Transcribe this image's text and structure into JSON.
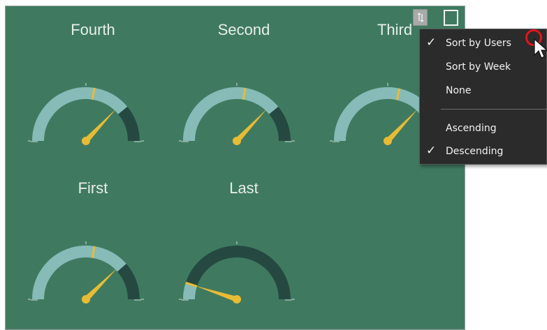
{
  "colors": {
    "panel_bg": "#3f7a60",
    "band_light": "#86bbb8",
    "band_dark": "#254941",
    "needle": "#e8bb34",
    "target_mark": "#e8bb34",
    "menu_bg": "#2b2b2b"
  },
  "gauges": [
    {
      "title": "Fourth",
      "band_fraction": 0.78,
      "value_fraction": 0.74,
      "target_fraction": 0.55
    },
    {
      "title": "Second",
      "band_fraction": 0.78,
      "value_fraction": 0.74,
      "target_fraction": 0.55
    },
    {
      "title": "Third",
      "band_fraction": 0.78,
      "value_fraction": 0.74,
      "target_fraction": 0.57
    },
    {
      "title": "First",
      "band_fraction": 0.77,
      "value_fraction": 0.75,
      "target_fraction": 0.55
    },
    {
      "title": "Last",
      "band_fraction": 0.1,
      "value_fraction": 0.1,
      "target_fraction": 0.1
    }
  ],
  "toolbar": {
    "sort_icon": "sort-arrows-icon",
    "focus_icon": "focus-mode-icon"
  },
  "menu": {
    "items": [
      {
        "label": "Sort by Users",
        "checked": true
      },
      {
        "label": "Sort by Week",
        "checked": false
      },
      {
        "label": "None",
        "checked": false
      },
      {
        "label": "Ascending",
        "checked": false
      },
      {
        "label": "Descending",
        "checked": true
      }
    ],
    "check_glyph": "✓"
  }
}
